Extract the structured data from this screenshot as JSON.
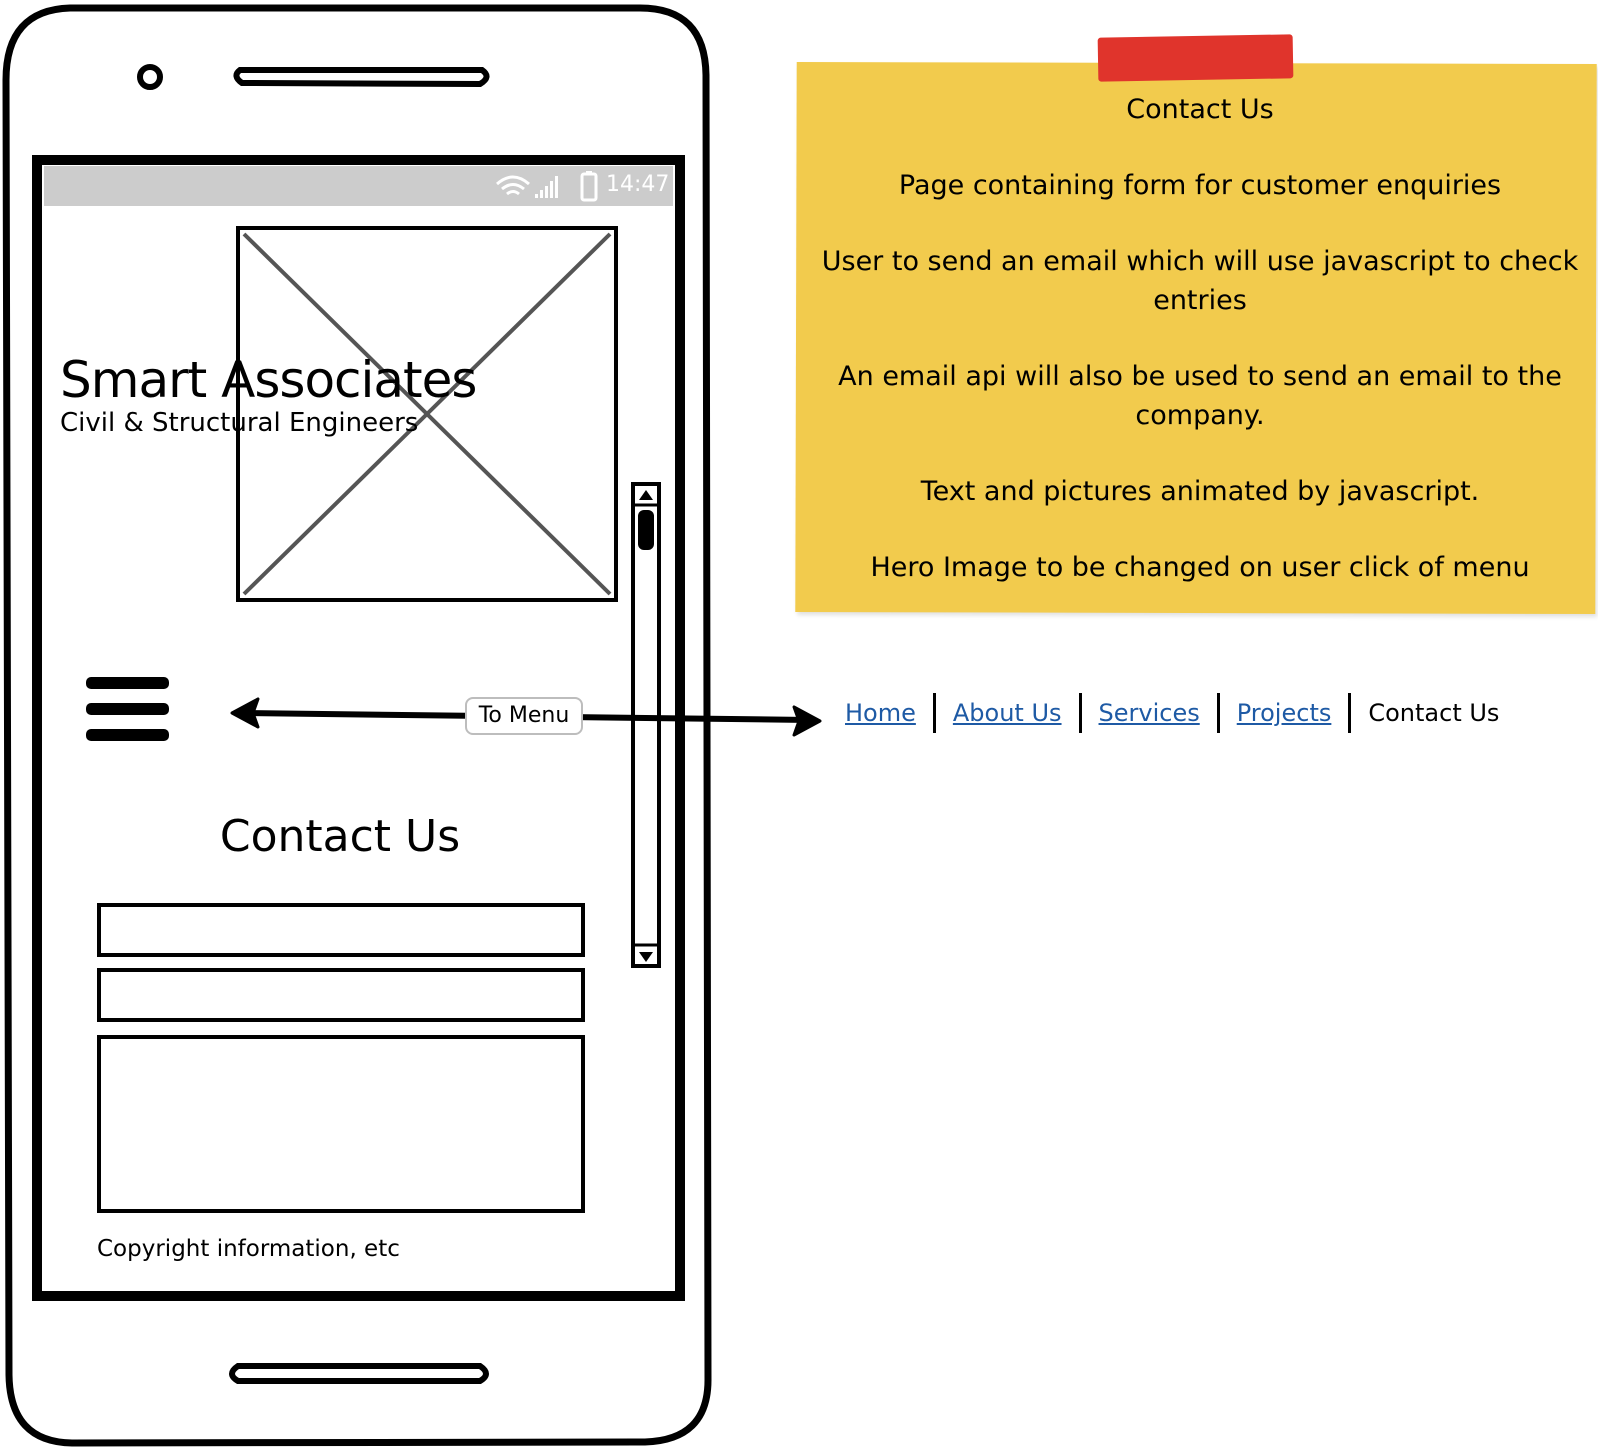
{
  "phone": {
    "status_bar": {
      "time": "14:47"
    },
    "brand": {
      "title": "Smart Associates",
      "subtitle": "Civil & Structural Engineers"
    },
    "menu_callout": "To Menu",
    "page_heading": "Contact Us",
    "footer": {
      "copyright": "Copyright information, etc"
    }
  },
  "note": {
    "title": "Contact Us",
    "lines": [
      "Page containing form for customer enquiries",
      "User to send an email which will use javascript to check entries",
      "An email api will also be used to send an email to the company.",
      "Text and pictures animated by javascript.",
      "Hero Image to be changed on user click of menu"
    ]
  },
  "nav": {
    "links": [
      "Home",
      "About Us",
      "Services",
      "Projects"
    ],
    "current": "Contact Us"
  },
  "colors": {
    "note_bg": "#f2cb4d",
    "tape": "#e0342c",
    "link": "#1e5aa5",
    "status_bar": "#cccccc"
  }
}
